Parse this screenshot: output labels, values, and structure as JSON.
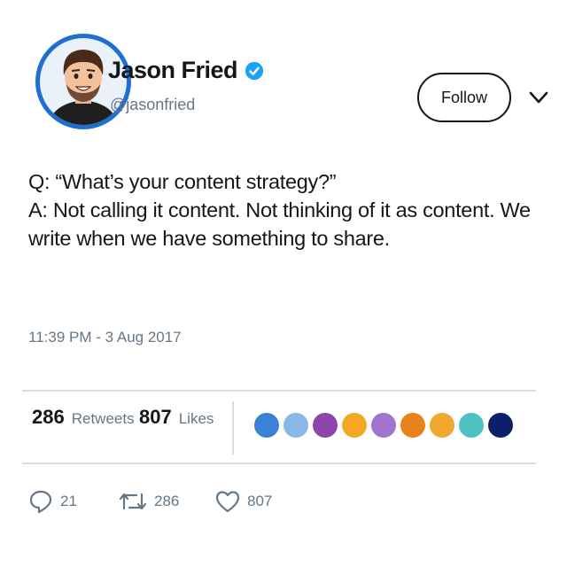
{
  "profile": {
    "display_name": "Jason Fried",
    "handle": "@jasonfried",
    "follow_label": "Follow"
  },
  "tweet": {
    "lines": [
      "Q: “What’s your content strategy?”",
      "A: Not calling it content. Not thinking of it as content. We",
      "write when we have something to share."
    ],
    "timestamp": "11:39 PM - 3 Aug 2017"
  },
  "stats": {
    "retweets_count": "286",
    "retweets_label": "Retweets",
    "likes_count": "807",
    "likes_label": "Likes"
  },
  "likers": [
    {
      "color": "#3b82d6"
    },
    {
      "color": "#8ab8e6"
    },
    {
      "color": "#8e44ad"
    },
    {
      "color": "#f5a623"
    },
    {
      "color": "#a374cf"
    },
    {
      "color": "#e8821a"
    },
    {
      "color": "#f0a830"
    },
    {
      "color": "#4fc1c0"
    },
    {
      "color": "#0d1f6b"
    }
  ],
  "actions": {
    "replies": "21",
    "retweets": "286",
    "likes": "807"
  },
  "icons": {
    "verified": "verified-badge-icon",
    "chevron": "chevron-down-icon",
    "reply": "reply-icon",
    "retweet": "retweet-icon",
    "like": "heart-icon"
  },
  "colors": {
    "accent": "#1da1f2",
    "avatar_ring": "#1e6fd0"
  }
}
